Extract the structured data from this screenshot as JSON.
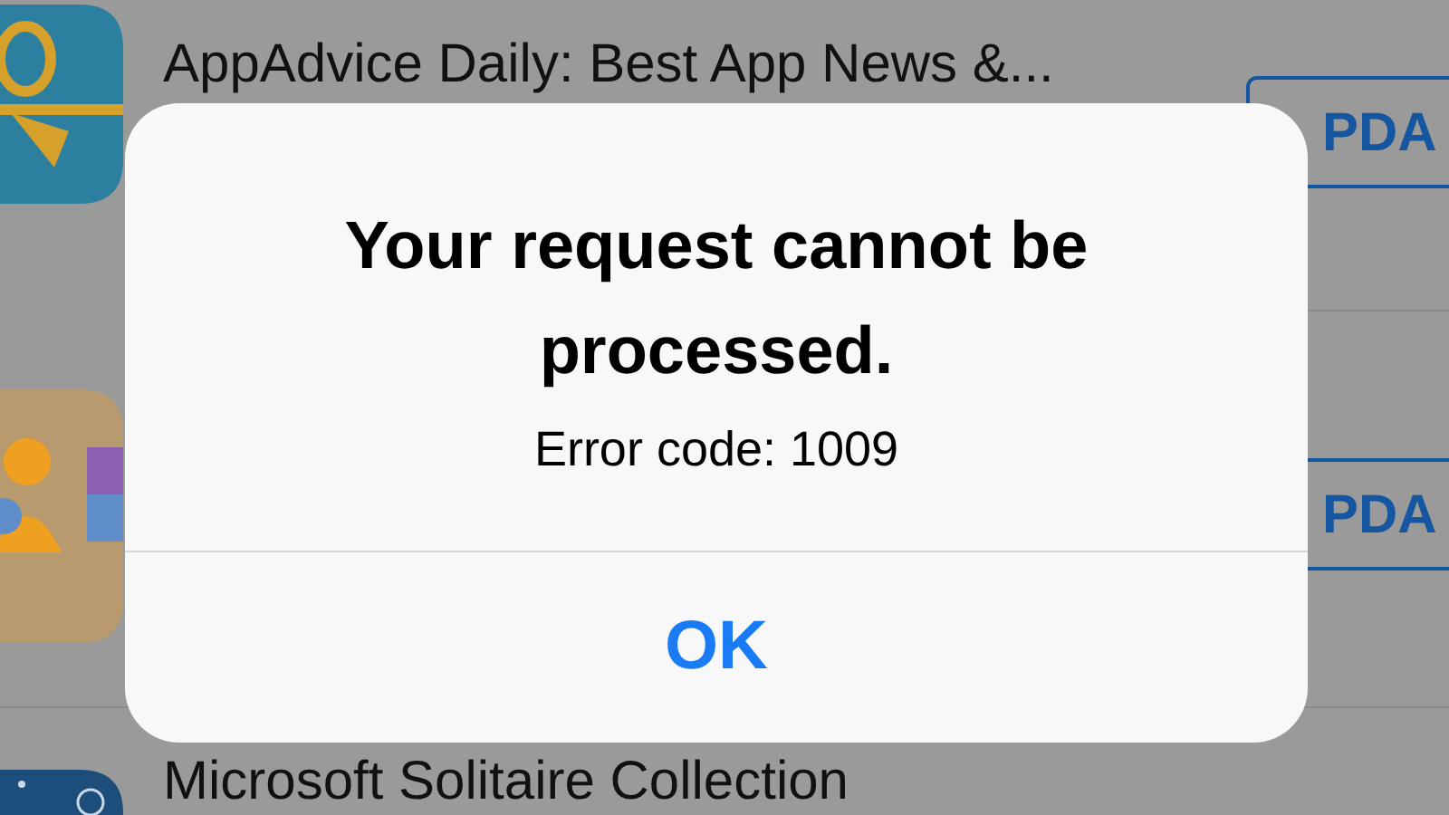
{
  "apps": [
    {
      "kind": "gift",
      "name": "AppAdvice Daily: Best App News &...",
      "action": "PDA"
    },
    {
      "kind": "people",
      "action": "PDA"
    },
    {
      "kind": "cards",
      "name": "Microsoft Solitaire Collection"
    }
  ],
  "alert": {
    "title": "Your request cannot be processed.",
    "message": "Error code: 1009",
    "buttons": [
      "OK"
    ]
  }
}
